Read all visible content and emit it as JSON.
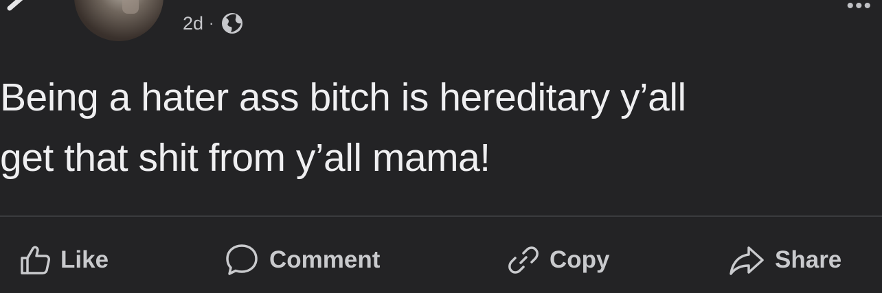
{
  "post": {
    "timestamp": "2d",
    "separator": "·",
    "privacy_icon": "globe-icon",
    "text_line1": "Being a hater ass bitch is hereditary y’all",
    "text_line2": "get that shit from y’all mama!"
  },
  "actions": {
    "like_label": "Like",
    "comment_label": "Comment",
    "copy_label": "Copy",
    "share_label": "Share"
  },
  "icons": {
    "back": "chevron-left-icon",
    "more": "more-icon",
    "like": "thumbs-up-icon",
    "comment": "speech-bubble-icon",
    "copy": "link-icon",
    "share": "share-arrow-icon"
  },
  "colors": {
    "background": "#232325",
    "text": "#efeff1",
    "secondary_text": "#c9cacd",
    "divider": "#3a3b3e"
  }
}
